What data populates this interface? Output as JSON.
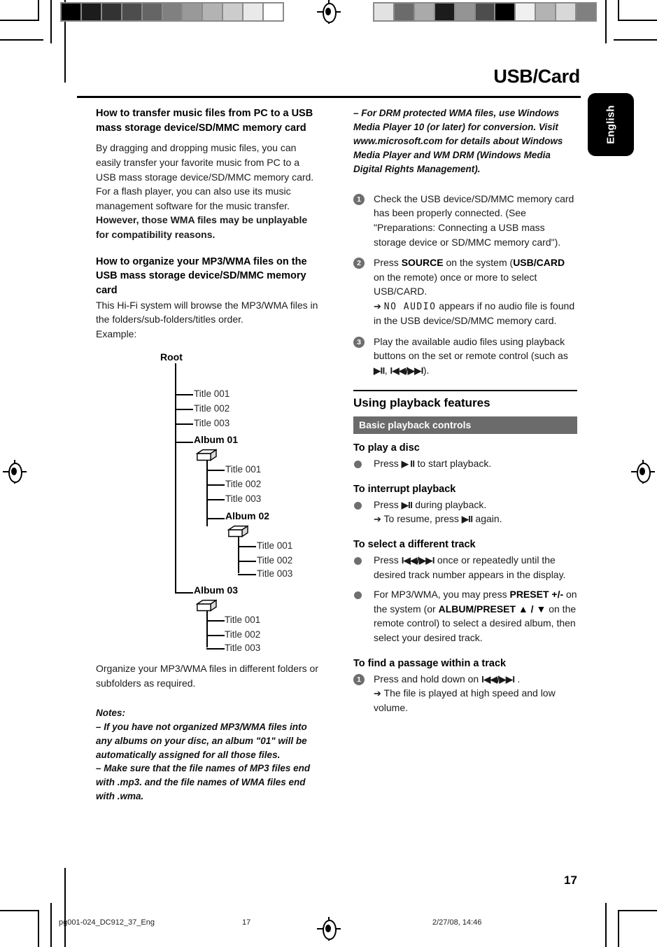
{
  "document": {
    "title": "USB/Card",
    "language_tab": "English",
    "page_number": "17"
  },
  "footer": {
    "filename": "pg001-024_DC912_37_Eng",
    "page": "17",
    "timestamp": "2/27/08, 14:46"
  },
  "left_column": {
    "heading1": "How to transfer music files from PC to a USB mass storage device/SD/MMC memory card",
    "para1": "By dragging and dropping music files, you can easily transfer your favorite music from PC to a USB mass storage device/SD/MMC memory card.",
    "para2": "For a flash player, you can also use its music management software for the music transfer.",
    "para2_bold": "However, those WMA files may be unplayable for compatibility reasons.",
    "heading2": "How to organize your MP3/WMA files on the USB mass storage device/SD/MMC memory card",
    "para3": "This Hi-Fi system will browse the MP3/WMA files in the folders/sub-folders/titles order.",
    "para4": "Example:",
    "para5": "Organize your MP3/WMA files in different folders or subfolders as required.",
    "notes_label": "Notes:",
    "note1": "–  If you have not organized MP3/WMA files into any albums on your disc, an album \"01\" will be automatically assigned for all those files.",
    "note2": "–  Make sure that the file names of MP3 files end with .mp3. and the file names of WMA files end with .wma."
  },
  "tree": {
    "root": "Root",
    "root_titles": [
      "Title 001",
      "Title 002",
      "Title 003"
    ],
    "album01": "Album 01",
    "album01_titles": [
      "Title 001",
      "Title 002",
      "Title 003"
    ],
    "album02": "Album 02",
    "album02_titles": [
      "Title 001",
      "Title 002",
      "Title 003"
    ],
    "album03": "Album 03",
    "album03_titles": [
      "Title 001",
      "Title 002",
      "Title 003"
    ]
  },
  "right_column": {
    "drm_note": "–  For DRM protected WMA files, use Windows Media Player 10 (or later) for conversion. Visit www.microsoft.com for details about Windows Media Player and WM DRM (Windows Media Digital Rights Management).",
    "steps": [
      {
        "num": "1",
        "text": "Check the USB device/SD/MMC memory card has been properly connected. (See \"Preparations: Connecting a USB mass storage device or SD/MMC memory card\")."
      },
      {
        "num": "2",
        "text_a": "Press ",
        "bold_a": "SOURCE",
        "text_b": " on the system (",
        "bold_b": "USB/CARD",
        "text_c": " on the remote) once or more to select USB/CARD.",
        "arrow": "➔",
        "lcd": "NO AUDIO",
        "arrow_text": " appears if no audio file is found in the USB device/SD/MMC memory card."
      },
      {
        "num": "3",
        "text_a": "Play the available audio files using playback buttons on the set or remote control (such as ",
        "sym_a": "▶II",
        "text_b": ", ",
        "sym_b": "I◀◀/▶▶I",
        "text_c": ")."
      }
    ],
    "features": {
      "title": "Using playback features",
      "bar_label": "Basic playback controls",
      "sub1": "To play a disc",
      "sub1_item_a": "Press ",
      "sub1_sym": "▶ II",
      "sub1_item_b": " to start playback.",
      "sub2": "To interrupt playback",
      "sub2_item_a": "Press ",
      "sub2_sym": "▶II",
      "sub2_item_b": " during playback.",
      "sub2_arrow": "➔",
      "sub2_arrow_a": " To resume, press ",
      "sub2_arrow_sym": "▶II",
      "sub2_arrow_b": " again.",
      "sub3": "To select a different track",
      "sub3_item1_a": "Press ",
      "sub3_item1_sym": "I◀◀/▶▶I",
      "sub3_item1_b": " once or repeatedly until the desired track number appears in the display.",
      "sub3_item2_a": "For MP3/WMA, you may press ",
      "sub3_item2_bold1": "PRESET +/-",
      "sub3_item2_b": " on the system (or ",
      "sub3_item2_bold2": "ALBUM/PRESET ▲ / ▼",
      "sub3_item2_c": " on the remote control) to select a desired album, then select your desired track.",
      "sub4": "To find a passage within a track",
      "sub4_num": "1",
      "sub4_item_a": "Press and hold down on ",
      "sub4_item_sym": "I◀◀/▶▶I",
      "sub4_item_b": " .",
      "sub4_arrow": "➔",
      "sub4_arrow_text": " The file is played at high speed and low volume."
    }
  },
  "calibration": {
    "left_bar": [
      "#000000",
      "#1c1c1c",
      "#333333",
      "#4d4d4d",
      "#656565",
      "#808080",
      "#999999",
      "#b3b3b3",
      "#cccccc",
      "#e9e9e9",
      "#ffffff"
    ],
    "right_bar": [
      "#e2e2e2",
      "#6b6b6b",
      "#aaaaaa",
      "#1c1c1c",
      "#949494",
      "#4d4d4d",
      "#000000",
      "#f0f0f0",
      "#b3b3b3",
      "#d8d8d8",
      "#808080"
    ]
  }
}
